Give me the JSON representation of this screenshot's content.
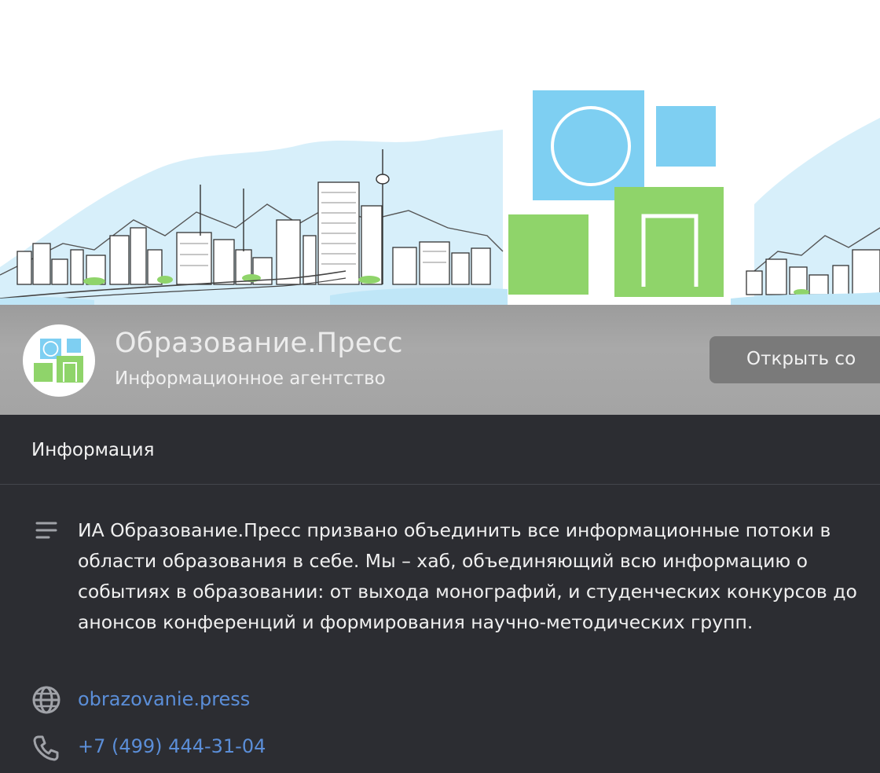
{
  "profile": {
    "title": "Образование.Пресс",
    "subtitle": "Информационное агентство",
    "open_button_label": "Открыть со"
  },
  "info": {
    "section_title": "Информация",
    "description": "ИА Образование.Пресс призвано объединить все информационные потоки в области образования в себе. Мы – хаб, объединяющий всю информацию о событиях в образовании: от выхода монографий, и студенческих конкурсов до анонсов конференций и формирования научно-методических групп.",
    "website": "obrazovanie.press",
    "phone": "+7 (499) 444-31-04"
  },
  "colors": {
    "logo_blue": "#7ecff2",
    "logo_green": "#8fd46a",
    "link": "#5b8ed8",
    "background": "#2c2d32"
  },
  "icons": {
    "description": "text-lines-icon",
    "website": "globe-icon",
    "phone": "phone-icon"
  }
}
